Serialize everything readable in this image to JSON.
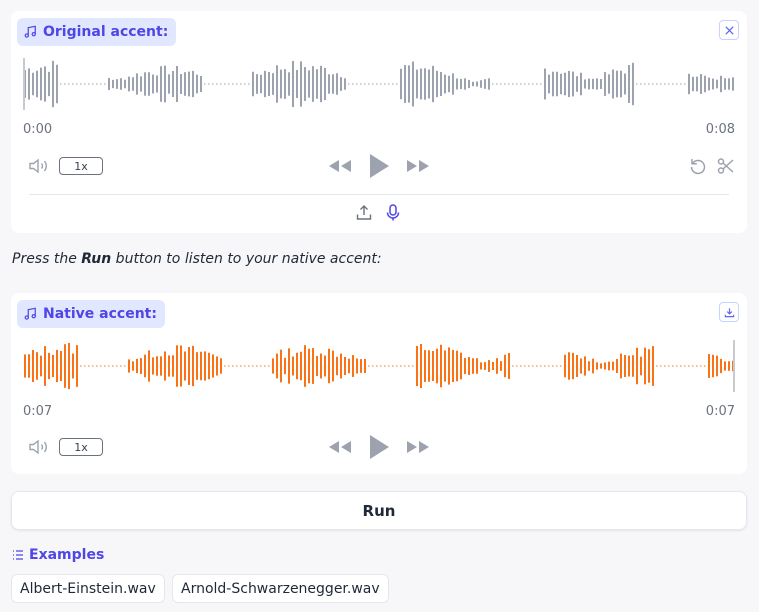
{
  "original": {
    "label": "Original accent:",
    "time_start": "0:00",
    "time_end": "0:08",
    "speed": "1x",
    "wave_color": "#9ca3af",
    "progress_fraction": 0.0,
    "icons": [
      "music-note-icon",
      "close-icon",
      "volume-icon",
      "rewind-icon",
      "play-icon",
      "fast-forward-icon",
      "undo-icon",
      "scissors-icon",
      "upload-icon",
      "microphone-icon"
    ]
  },
  "instruction": {
    "prefix": "Press the ",
    "bold": "Run",
    "suffix": " button to listen to your native accent:"
  },
  "native": {
    "label": "Native accent:",
    "time_start": "0:07",
    "time_end": "0:07",
    "speed": "1x",
    "wave_color": "#f97316",
    "progress_fraction": 1.0,
    "icons": [
      "music-note-icon",
      "download-icon",
      "volume-icon",
      "rewind-icon",
      "play-icon",
      "fast-forward-icon"
    ]
  },
  "run_label": "Run",
  "examples": {
    "header": "Examples",
    "items": [
      "Albert-Einstein.wav",
      "Arnold-Schwarzenegger.wav"
    ]
  },
  "colors": {
    "accent": "#4f46e5",
    "accent_bg": "#e0e7ff",
    "waveform_original": "#9ca3af",
    "waveform_native": "#f97316"
  }
}
